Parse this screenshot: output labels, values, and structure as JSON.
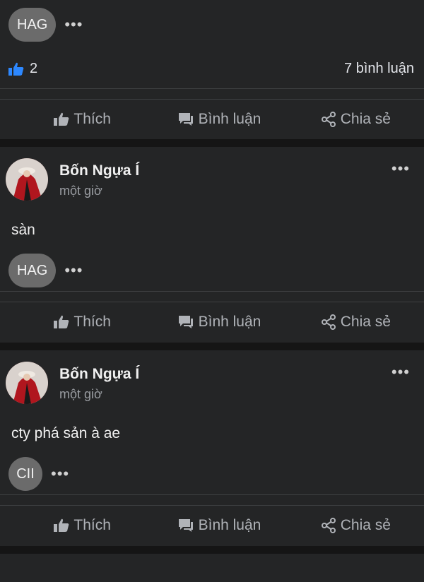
{
  "top": {
    "tag": "HAG",
    "more": "•••",
    "likes": "2",
    "comments": "7 bình luận"
  },
  "actions": {
    "like": "Thích",
    "comment": "Bình luận",
    "share": "Chia sẻ"
  },
  "posts": [
    {
      "name": "Bốn Ngựa Í",
      "time": "một giờ",
      "text": "sàn",
      "tag": "HAG",
      "more": "•••",
      "tag_more": "•••"
    },
    {
      "name": "Bốn Ngựa Í",
      "time": "một giờ",
      "text": "cty phá sản à ae",
      "tag": "CII",
      "more": "•••",
      "tag_more": "•••"
    }
  ],
  "colors": {
    "accent_like": "#2d88ff",
    "card": "#242526",
    "background": "#151515"
  },
  "icons": [
    "thumbs-up-icon",
    "comment-icon",
    "share-icon",
    "more-icon"
  ]
}
